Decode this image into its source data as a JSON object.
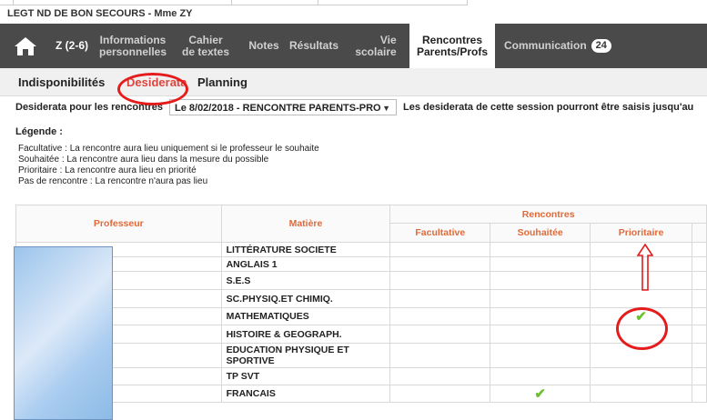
{
  "header": {
    "school": "LEGT ND DE BON SECOURS - Mme ZY"
  },
  "nav": {
    "class_label": "Z (2-6)",
    "items": [
      {
        "line1": "Informations",
        "line2": "personnelles"
      },
      {
        "line1": "Cahier",
        "line2": "de textes"
      },
      {
        "line1": "Notes",
        "line2": ""
      },
      {
        "line1": "Résultats",
        "line2": ""
      },
      {
        "line1": "Vie",
        "line2": "scolaire"
      },
      {
        "line1": "Rencontres",
        "line2": "Parents/Profs"
      },
      {
        "line1": "Communication",
        "line2": ""
      }
    ],
    "communication_badge": "24"
  },
  "subtabs": [
    "Indisponibilités",
    "Desiderata",
    "Planning"
  ],
  "selection": {
    "label": "Desiderata pour les rencontres",
    "value": "Le 8/02/2018 - RENCONTRE PARENTS-PRO",
    "notice": "Les desiderata de cette session pourront être saisis jusqu'au"
  },
  "legend": {
    "title": "Légende :",
    "lines": [
      "Facultative : La rencontre aura lieu uniquement si le professeur le souhaite",
      "Souhaitée : La rencontre aura lieu dans la mesure du possible",
      "Prioritaire : La rencontre aura lieu en priorité",
      "Pas de rencontre : La rencontre n'aura pas lieu"
    ]
  },
  "table": {
    "col_professeur": "Professeur",
    "col_matiere": "Matière",
    "group_rencontres": "Rencontres",
    "col_facultative": "Facultative",
    "col_souhaitee": "Souhaitée",
    "col_prioritaire": "Prioritaire",
    "rows": [
      {
        "subject": "LITTÉRATURE SOCIETE",
        "choice": ""
      },
      {
        "subject": "ANGLAIS 1",
        "choice": ""
      },
      {
        "subject": "S.E.S",
        "choice": ""
      },
      {
        "subject": "SC.PHYSIQ.ET CHIMIQ.",
        "choice": ""
      },
      {
        "subject": "MATHEMATIQUES",
        "choice": "prioritaire"
      },
      {
        "subject": "HISTOIRE & GEOGRAPH.",
        "choice": ""
      },
      {
        "subject": "EDUCATION PHYSIQUE ET SPORTIVE",
        "choice": ""
      },
      {
        "subject": "TP SVT",
        "choice": ""
      },
      {
        "subject": "FRANCAIS",
        "choice": "souhaitee"
      }
    ]
  },
  "check_glyph": "✔",
  "colors": {
    "accent": "#e06a3a",
    "nav_bg": "#4a4a4a",
    "check": "#6cbf2f",
    "annotation": "#e41c1c"
  }
}
